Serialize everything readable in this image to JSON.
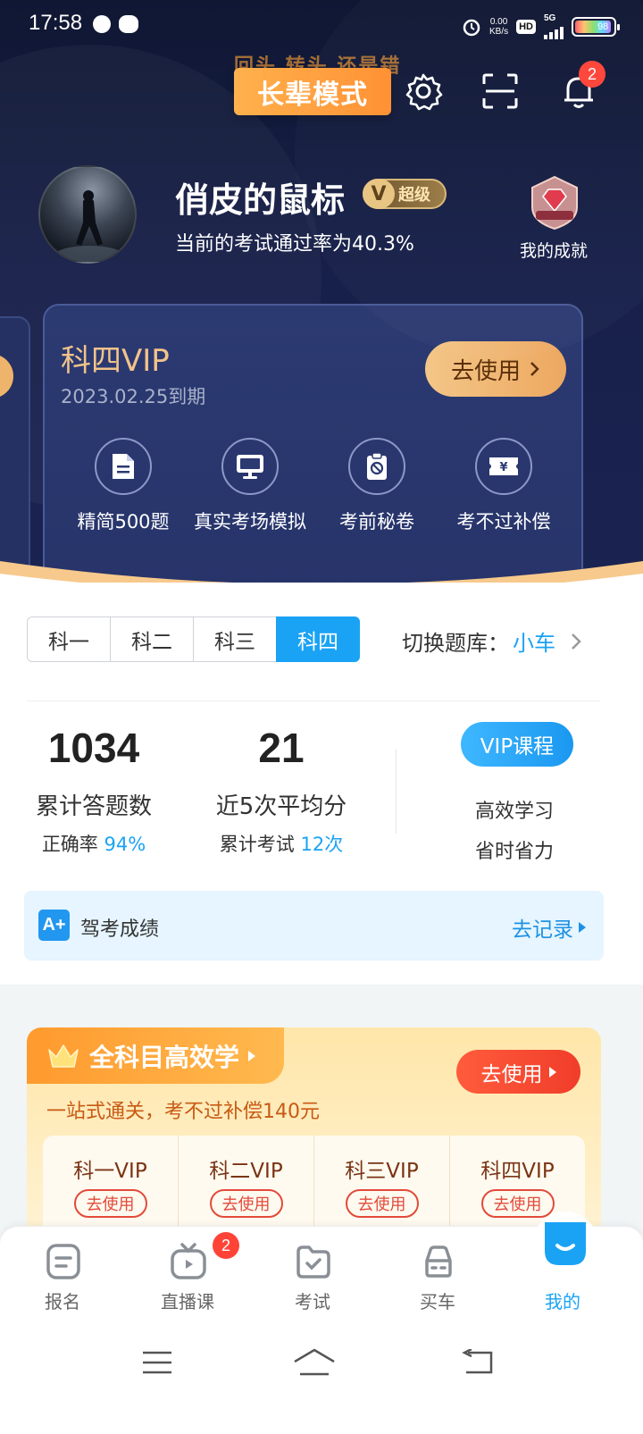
{
  "status_bar": {
    "time": "17:58",
    "net_speed_value": "0.00",
    "net_speed_unit": "KB/s",
    "hd": "HD",
    "network": "5G",
    "battery": "98"
  },
  "header": {
    "elder_mode_bg_text": "回头 转头 还是错",
    "elder_mode_label": "长辈模式",
    "notification_count": "2"
  },
  "profile": {
    "username": "俏皮的鼠标",
    "vip_level": "超级",
    "vip_letter": "V",
    "pass_rate_text": "当前的考试通过率为40.3%",
    "achievement_label": "我的成就"
  },
  "vip_card": {
    "title": "科四VIP",
    "expiry": "2023.02.25到期",
    "use_button": "去使用",
    "features": [
      {
        "label": "精简500题",
        "icon": "document-icon"
      },
      {
        "label": "真实考场模拟",
        "icon": "monitor-icon"
      },
      {
        "label": "考前秘卷",
        "icon": "secret-paper-icon"
      },
      {
        "label": "考不过补偿",
        "icon": "ticket-icon"
      }
    ]
  },
  "subject_tabs": [
    "科一",
    "科二",
    "科三",
    "科四"
  ],
  "active_subject": "科四",
  "switch_bank": {
    "label": "切换题库：",
    "value": "小车"
  },
  "stats": {
    "total_answered": "1034",
    "total_answered_label": "累计答题数",
    "accuracy_label": "正确率",
    "accuracy": "94%",
    "avg_score": "21",
    "avg_score_label": "近5次平均分",
    "exams_label": "累计考试",
    "exams_count": "12次"
  },
  "vip_course": {
    "button": "VIP课程",
    "line1": "高效学习",
    "line2": "省时省力"
  },
  "driving_score": {
    "icon_letter": "A+",
    "label": "驾考成绩",
    "action": "去记录"
  },
  "promo": {
    "title": "全科目高效学",
    "button": "去使用",
    "subtitle": "一站式通关，考不过补偿140元",
    "subjects": [
      {
        "name": "科一VIP",
        "action": "去使用"
      },
      {
        "name": "科二VIP",
        "action": "去使用"
      },
      {
        "name": "科三VIP",
        "action": "去使用"
      },
      {
        "name": "科四VIP",
        "action": "去使用"
      }
    ]
  },
  "bottom_nav": {
    "items": [
      "报名",
      "直播课",
      "考试",
      "买车",
      "我的"
    ],
    "live_badge": "2",
    "active": "我的"
  },
  "colors": {
    "accent": "#1aa3f5",
    "gold": "#f1c38a",
    "orange": "#ff9a2e",
    "red": "#ff4437"
  }
}
